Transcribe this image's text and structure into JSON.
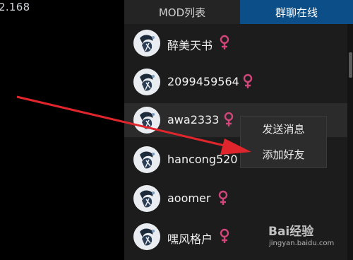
{
  "ip_fragment": "2.168",
  "tabs": [
    {
      "label": "MOD列表"
    },
    {
      "label": "群聊在线"
    }
  ],
  "users": [
    {
      "name": "醉美天书",
      "gender": "female"
    },
    {
      "name": "2099459564",
      "gender": "female"
    },
    {
      "name": "awa2333",
      "gender": "female"
    },
    {
      "name": "hancong520",
      "gender": "female"
    },
    {
      "name": "aoomer",
      "gender": "female"
    },
    {
      "name": "嘿风格户",
      "gender": "female"
    }
  ],
  "context_menu": {
    "items": [
      {
        "label": "发送消息"
      },
      {
        "label": "添加好友"
      }
    ]
  },
  "watermark": {
    "text": "Bai经验",
    "url": "jingyan.baidu.com"
  },
  "colors": {
    "panel_bg": "#1c1c1c",
    "active_tab": "#0c4f88",
    "gender_icon": "#d0457a",
    "arrow": "#e0262c"
  }
}
